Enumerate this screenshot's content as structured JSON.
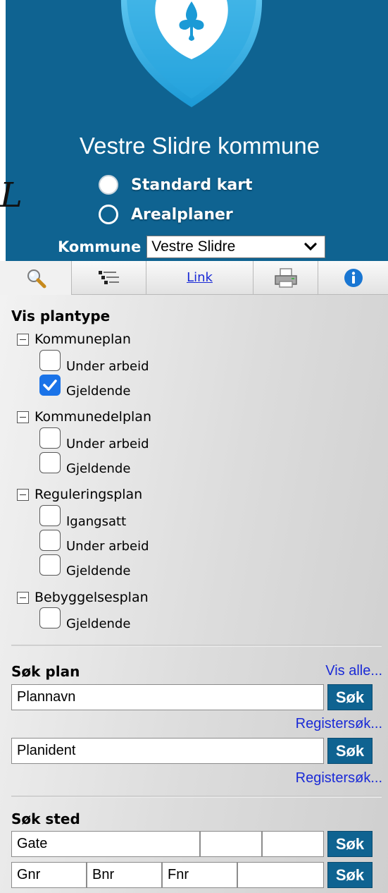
{
  "header": {
    "left_glyph": "L",
    "municipality": "Vestre Slidre kommune",
    "radio_options": [
      "Standard kart",
      "Arealplaner"
    ],
    "radio_selected": "Arealplaner",
    "kommune_label": "Kommune",
    "kommune_value": "Vestre Slidre"
  },
  "tabs": [
    {
      "icon": "search-icon",
      "active": true
    },
    {
      "icon": "legend-icon"
    },
    {
      "label": "Link"
    },
    {
      "icon": "printer-icon"
    },
    {
      "icon": "info-icon"
    }
  ],
  "plantype": {
    "heading": "Vis plantype",
    "groups": [
      {
        "label": "Kommuneplan",
        "items": [
          {
            "label": "Under arbeid",
            "checked": false
          },
          {
            "label": "Gjeldende",
            "checked": true
          }
        ]
      },
      {
        "label": "Kommunedelplan",
        "items": [
          {
            "label": "Under arbeid",
            "checked": false
          },
          {
            "label": "Gjeldende",
            "checked": false
          }
        ]
      },
      {
        "label": "Reguleringsplan",
        "items": [
          {
            "label": "Igangsatt",
            "checked": false
          },
          {
            "label": "Under arbeid",
            "checked": false
          },
          {
            "label": "Gjeldende",
            "checked": false
          }
        ]
      },
      {
        "label": "Bebyggelsesplan",
        "items": [
          {
            "label": "Gjeldende",
            "checked": false
          }
        ]
      }
    ]
  },
  "sok_plan": {
    "heading": "Søk plan",
    "vis_alle": "Vis alle...",
    "plannavn_value": "Plannavn",
    "planident_value": "Planident",
    "registersok": "Registersøk...",
    "button": "Søk"
  },
  "sok_sted": {
    "heading": "Søk sted",
    "gate_value": "Gate",
    "gnr_value": "Gnr",
    "bnr_value": "Bnr",
    "fnr_value": "Fnr",
    "button": "Søk"
  },
  "colors": {
    "brand": "#0f6391",
    "link": "#1a2ad6",
    "check": "#1a73e8"
  }
}
